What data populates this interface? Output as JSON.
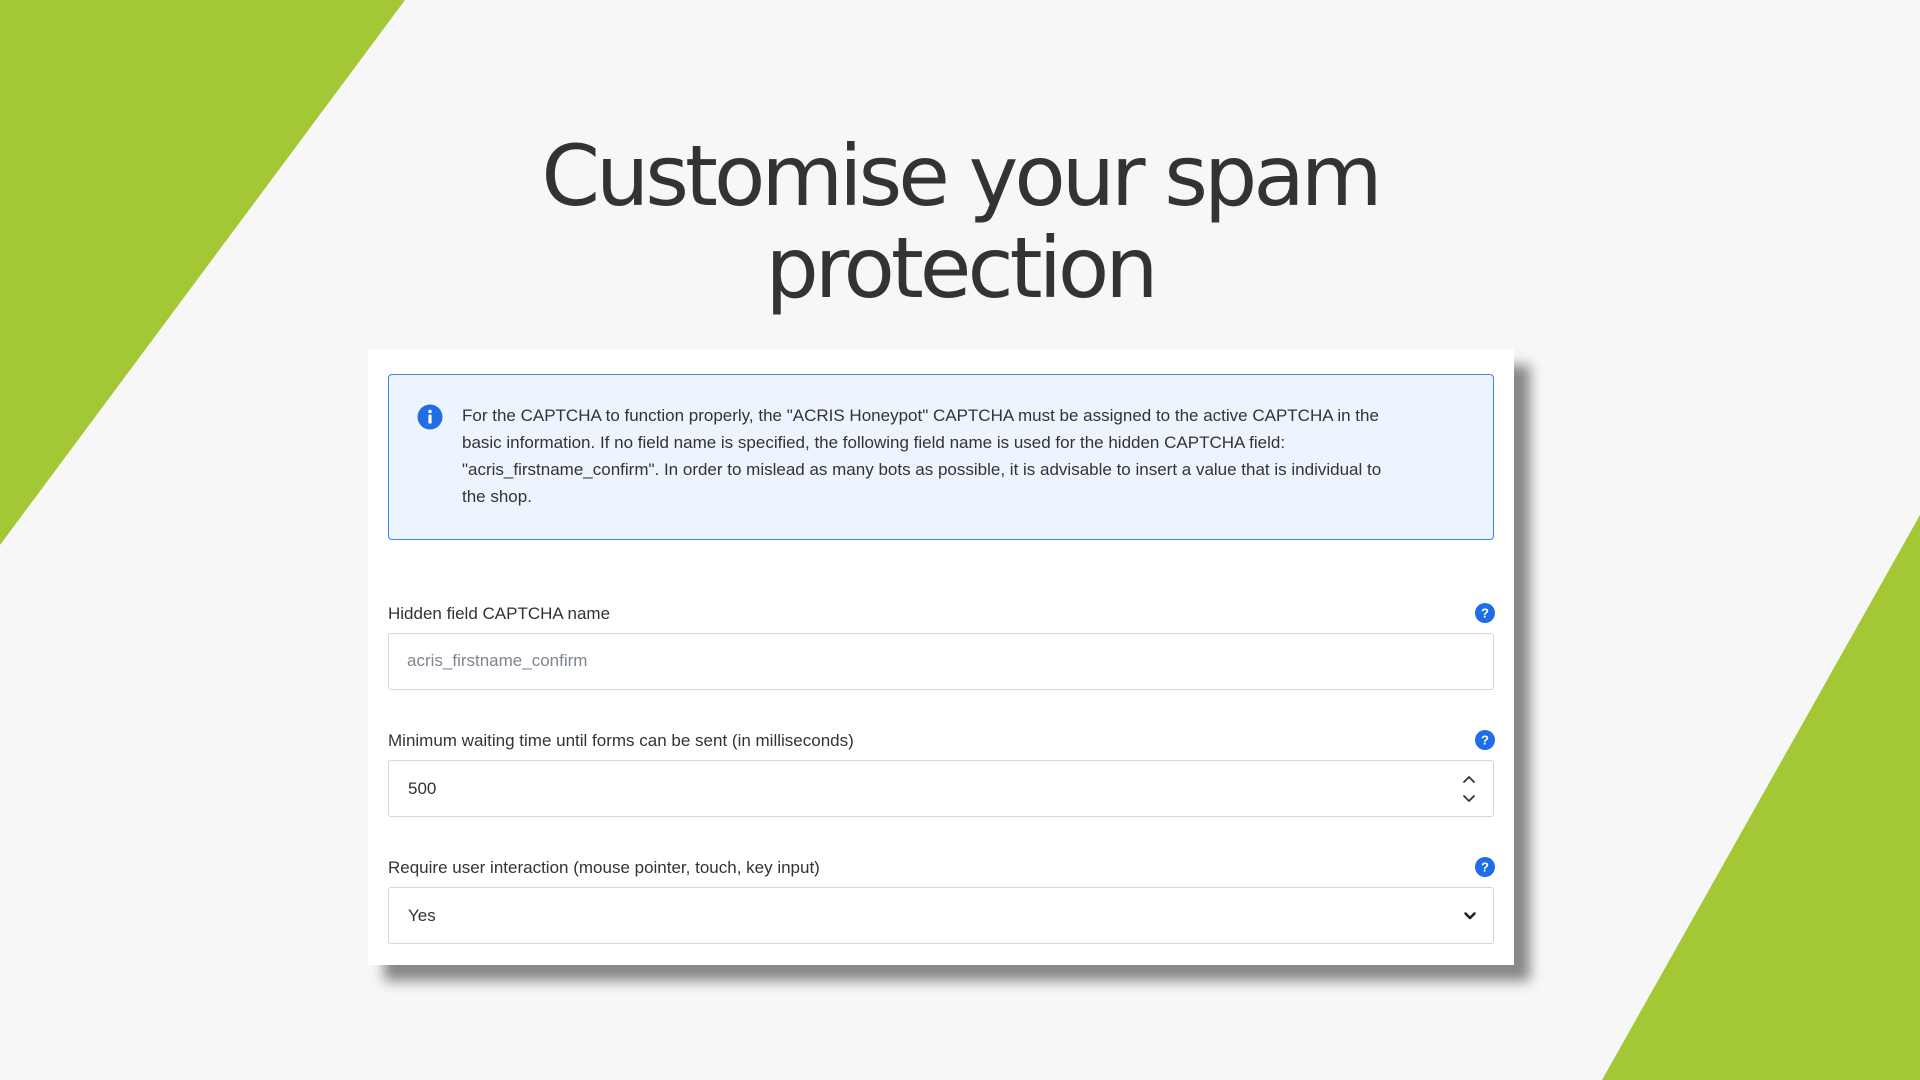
{
  "heading": {
    "line1": "Customise your spam",
    "line2": "protection"
  },
  "colors": {
    "accent_green": "#a4c736",
    "info_blue": "#1f6ee6",
    "alert_background": "#edf4fe",
    "alert_border": "#3a86e8"
  },
  "alert": {
    "icon": "info-icon",
    "line1": "For the CAPTCHA to function properly, the \"ACRIS Honeypot\" CAPTCHA must be assigned to the active CAPTCHA in the",
    "line2": "basic information. If no field name is specified, the following field name is used for the hidden CAPTCHA field:",
    "line3": "\"acris_firstname_confirm\". In order to mislead as many bots as possible, it is advisable to insert a value that is individual to",
    "line4": "the shop."
  },
  "fields": {
    "hidden_name": {
      "label": "Hidden field CAPTCHA name",
      "placeholder": "acris_firstname_confirm",
      "value": "",
      "help_icon": "help-icon"
    },
    "min_wait": {
      "label": "Minimum waiting time until forms can be sent (in milliseconds)",
      "value": "500",
      "help_icon": "help-icon"
    },
    "user_interaction": {
      "label": "Require user interaction (mouse pointer, touch, key input)",
      "selected": "Yes",
      "help_icon": "help-icon"
    }
  }
}
